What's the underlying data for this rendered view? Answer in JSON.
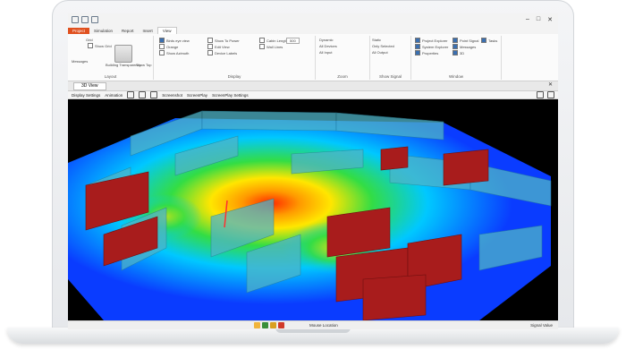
{
  "app": {
    "ribbon_tabs": [
      "Project",
      "Simulation",
      "Report",
      "Insert",
      "View"
    ],
    "active_tab": "View",
    "ribbon": {
      "layout": {
        "label": "Layout",
        "grid_label": "Grid",
        "show_grid": "Show Grid",
        "messages": "Messages",
        "building_transparency": "Building Transparency",
        "show_top": "Show Top"
      },
      "display": {
        "label": "Display",
        "items": [
          "Birds eye view",
          "Orange",
          "Show Azimuth",
          "Show To Power",
          "Edit View",
          "Device Labels",
          "Cabin Length",
          "Wall Lines"
        ],
        "value_field": "500"
      },
      "zoom": {
        "label": "Zoom",
        "items": [
          "Dynamic",
          "All Devices",
          "All Input",
          "Static",
          "Only Selected",
          "All Output"
        ]
      },
      "show_signal": {
        "label": "Show Signal"
      },
      "windows": {
        "label": "Window",
        "items": [
          "Project Explorer",
          "System Explorer",
          "Properties",
          "Point Signal",
          "Messages",
          "3D",
          "Tasks"
        ]
      }
    },
    "view": {
      "tab_label": "3D View",
      "close": "✕",
      "toolbar_items": [
        "Display Settings",
        "Animation",
        "Screenshot",
        "ScreenPlay",
        "ScreenPlay Settings"
      ]
    },
    "status": {
      "center": "Mouse Location",
      "right": "Signal Value"
    }
  },
  "colors": {
    "file_tab": "#e0501e",
    "heat_red": "#ff2a00",
    "heat_yellow": "#ffe600",
    "heat_green": "#33dd44",
    "heat_cyan": "#00c8ff",
    "heat_blue": "#0a3cff",
    "wall_red": "#a81c1c",
    "wall_cyan": "#4fb4c8"
  },
  "icons": {
    "quick_access": [
      "save-icon",
      "undo-icon",
      "redo-icon"
    ],
    "window_controls": [
      "minimize-icon",
      "maximize-icon",
      "close-icon"
    ]
  }
}
